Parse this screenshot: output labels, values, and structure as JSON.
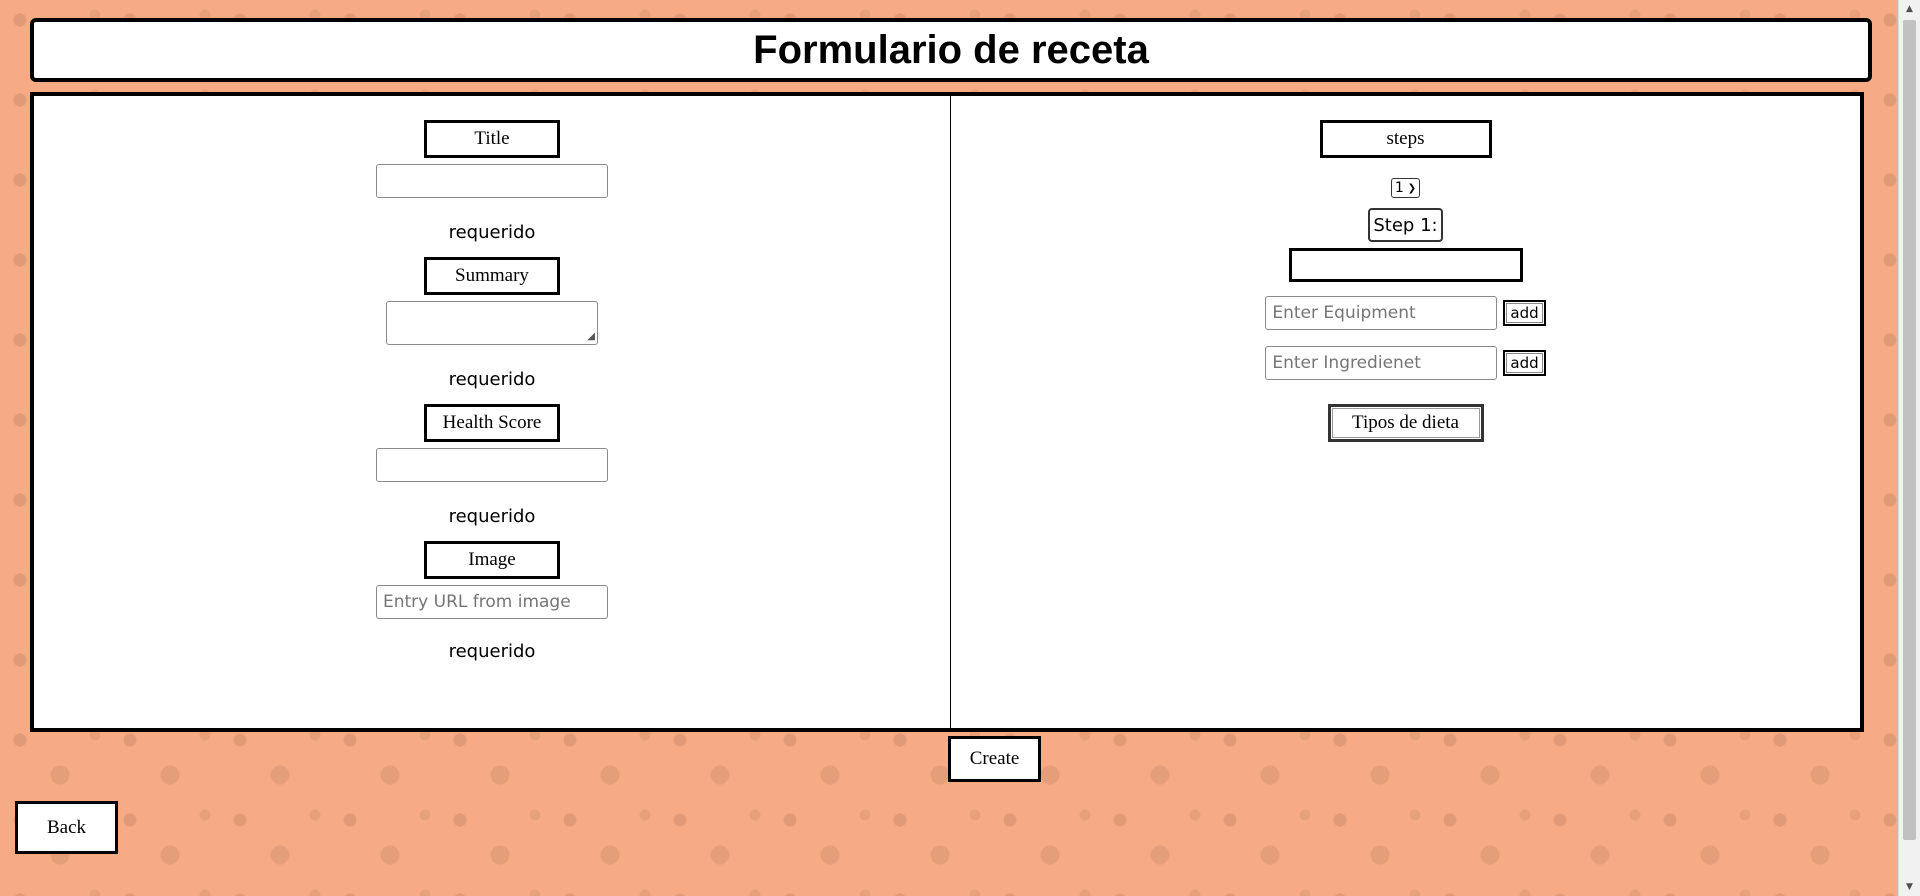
{
  "page": {
    "title": "Formulario de receta"
  },
  "left": {
    "title_label": "Title",
    "title_value": "",
    "title_error": "requerido",
    "summary_label": "Summary",
    "summary_value": "",
    "summary_error": "requerido",
    "health_label": "Health Score",
    "health_value": "",
    "health_error": "requerido",
    "image_label": "Image",
    "image_placeholder": "Entry URL from image",
    "image_error": "requerido"
  },
  "right": {
    "steps_label": "steps",
    "steps_count": "1",
    "step_label": "Step 1:",
    "step_value": "",
    "equipment_placeholder": "Enter Equipment",
    "equipment_add": "add",
    "ingredient_placeholder": "Enter Ingredienet",
    "ingredient_add": "add",
    "diet_label": "Tipos de dieta"
  },
  "actions": {
    "create": "Create",
    "back": "Back"
  },
  "colors": {
    "background": "#f7ab84",
    "panel": "#ffffff",
    "border": "#000000"
  },
  "icons": {
    "select_arrow": "chevron-down-icon",
    "resize": "resize-grip-icon"
  }
}
